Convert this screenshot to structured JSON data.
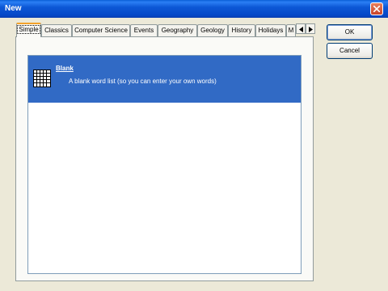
{
  "window": {
    "title": "New"
  },
  "tabs": [
    "Simple",
    "Classics",
    "Computer Science",
    "Events",
    "Geography",
    "Geology",
    "History",
    "Holidays",
    "M"
  ],
  "active_tab": "Simple",
  "list": {
    "items": [
      {
        "title": "Blank",
        "description": "A blank word list (so you can enter your own words)",
        "icon": "grid-icon",
        "selected": true
      }
    ]
  },
  "buttons": {
    "ok": "OK",
    "cancel": "Cancel"
  },
  "colors": {
    "selection": "#316ac5",
    "titlebar": "#0548c8",
    "dialog_bg": "#ece9d8"
  }
}
